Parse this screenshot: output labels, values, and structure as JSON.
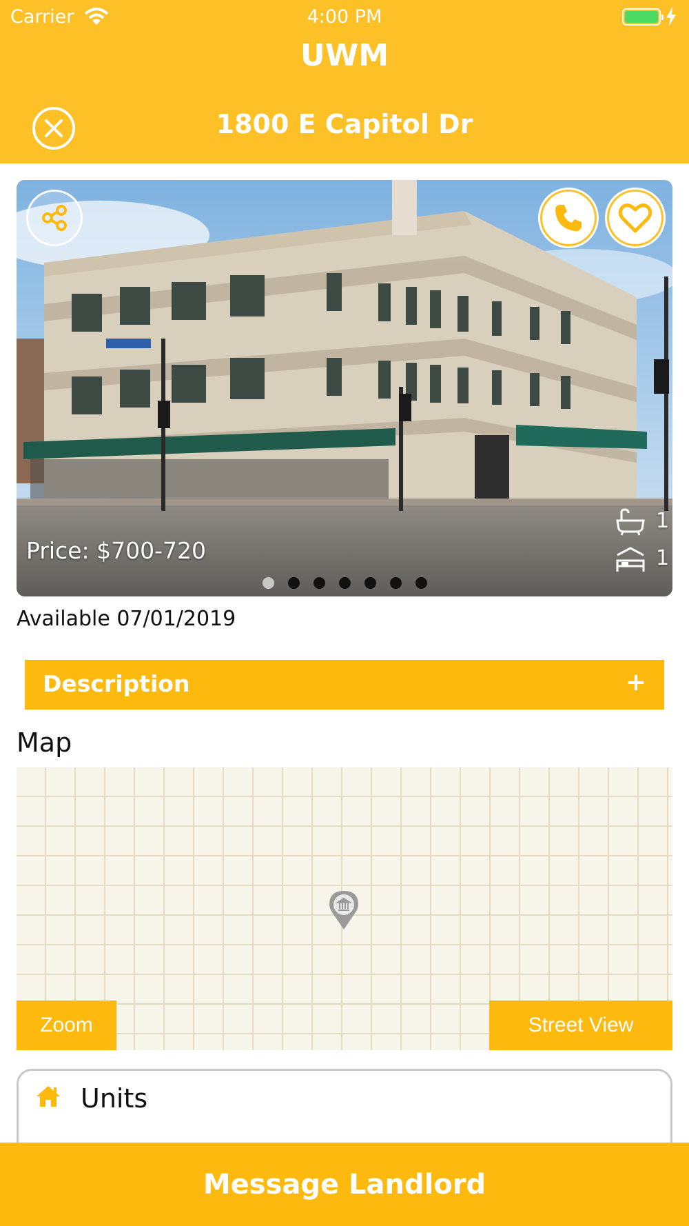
{
  "status_bar": {
    "carrier": "Carrier",
    "time": "4:00 PM"
  },
  "header": {
    "app_title": "UWM",
    "page_title": "1800 E Capitol Dr"
  },
  "photo": {
    "price": "Price: $700-720",
    "bathrooms": "1",
    "bedrooms": "1",
    "page_count": 7,
    "active_page": 0
  },
  "available": "Available 07/01/2019",
  "description": {
    "label": "Description",
    "toggle": "+"
  },
  "map": {
    "label": "Map",
    "zoom_label": "Zoom",
    "street_view_label": "Street View"
  },
  "units": {
    "label": "Units"
  },
  "message": {
    "label": "Message Landlord"
  },
  "colors": {
    "brand_yellow": "#FDC127",
    "button_yellow": "#FEB90E"
  }
}
